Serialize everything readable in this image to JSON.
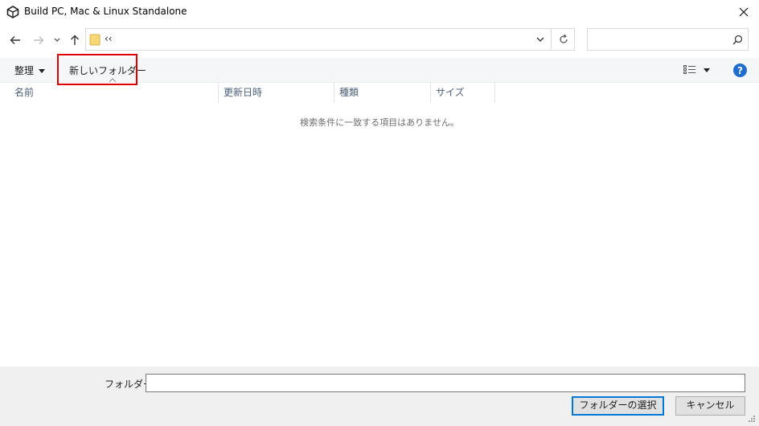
{
  "window": {
    "title": "Build PC, Mac & Linux Standalone",
    "app_icon": "unity-icon",
    "close_icon": "close-icon"
  },
  "nav": {
    "back_icon": "arrow-left-icon",
    "forward_icon": "arrow-right-icon",
    "recent_icon": "chevron-down-icon",
    "up_icon": "arrow-up-icon"
  },
  "address": {
    "folder_icon": "folder-icon",
    "text": "‹‹",
    "dropdown_icon": "chevron-down-icon",
    "refresh_icon": "refresh-icon"
  },
  "search": {
    "value": "",
    "placeholder": "",
    "icon": "search-icon"
  },
  "toolbar": {
    "organize_label": "整理",
    "new_folder_label": "新しいフォルダー",
    "view_icon": "details-view-icon",
    "help_label": "?"
  },
  "columns": [
    {
      "label": "名前"
    },
    {
      "label": "更新日時"
    },
    {
      "label": "種類"
    },
    {
      "label": "サイズ"
    }
  ],
  "list": {
    "empty_message": "検索条件に一致する項目はありません。",
    "items": []
  },
  "footer": {
    "folder_label": "フォルダー:",
    "folder_value": "",
    "select_button_label": "フォルダーの選択",
    "cancel_button_label": "キャンセル"
  },
  "colors": {
    "highlight": "#e00000",
    "accent": "#0078d7",
    "help_blue": "#1f6dd0",
    "folder_yellow": "#f8d775"
  }
}
